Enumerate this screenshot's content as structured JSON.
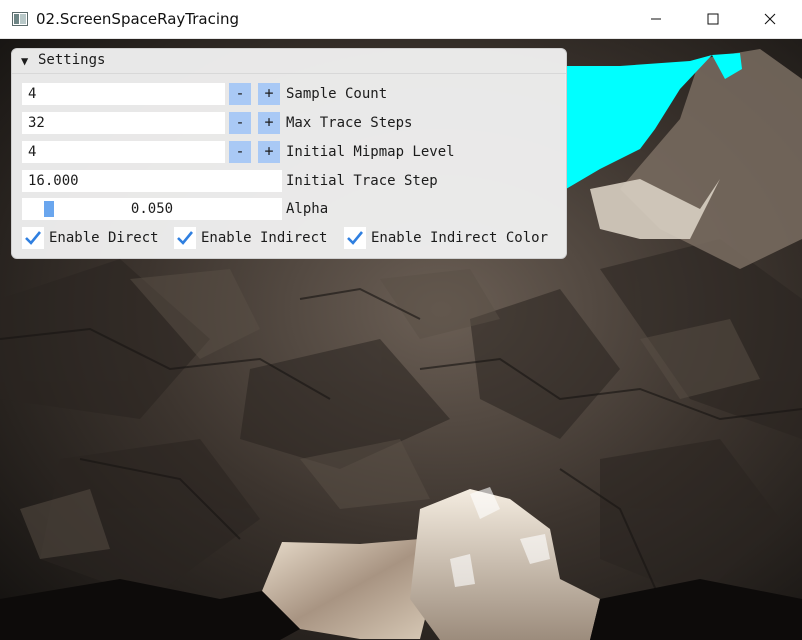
{
  "window": {
    "title": "02.ScreenSpaceRayTracing",
    "icon": "app-window-icon",
    "controls": [
      "minimize-icon",
      "maximize-icon",
      "close-icon"
    ]
  },
  "settings": {
    "title": "Settings",
    "collapse_icon": "triangle-down-icon",
    "sample_count": {
      "value": "4",
      "label": "Sample Count",
      "minus": "-",
      "plus": "+"
    },
    "max_trace_steps": {
      "value": "32",
      "label": "Max Trace Steps",
      "minus": "-",
      "plus": "+"
    },
    "initial_mipmap_level": {
      "value": "4",
      "label": "Initial Mipmap Level",
      "minus": "-",
      "plus": "+"
    },
    "initial_trace_step": {
      "value": "16.000",
      "label": "Initial Trace Step"
    },
    "alpha": {
      "value": "0.050",
      "label": "Alpha",
      "fraction": 0.05
    },
    "checkboxes": [
      {
        "label": "Enable Direct",
        "checked": true
      },
      {
        "label": "Enable Indirect",
        "checked": true
      },
      {
        "label": "Enable Indirect Color",
        "checked": true
      }
    ]
  },
  "colors": {
    "sky": "#00ffff",
    "button": "#a9c9f5",
    "slider_grab": "#6aa6ee",
    "check_mark": "#2f7fe0"
  }
}
